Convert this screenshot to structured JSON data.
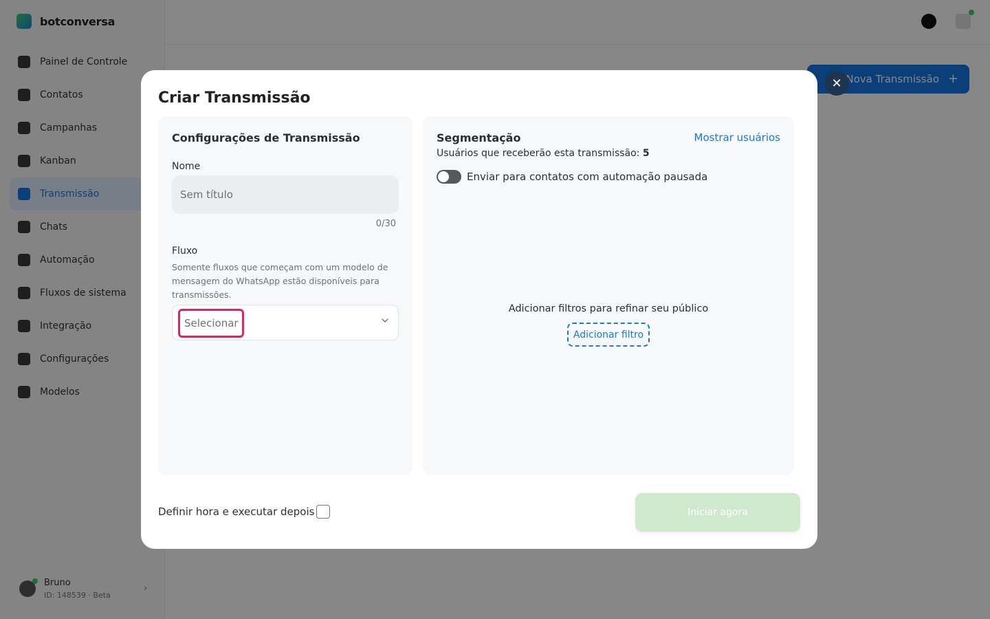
{
  "background": {
    "brand_name": "botconversa",
    "nav_items": [
      {
        "label": "Painel de Controle",
        "icon": "dashboard-icon"
      },
      {
        "label": "Contatos",
        "icon": "contacts-icon"
      },
      {
        "label": "Campanhas",
        "icon": "campaigns-icon"
      },
      {
        "label": "Kanban",
        "icon": "kanban-icon"
      },
      {
        "label": "Transmissão",
        "icon": "broadcast-icon",
        "active": true
      },
      {
        "label": "Chats",
        "icon": "chat-icon"
      },
      {
        "label": "Automação",
        "icon": "automation-icon"
      },
      {
        "label": "Fluxos de sistema",
        "icon": "flow-icon"
      },
      {
        "label": "Integração",
        "icon": "integration-icon"
      },
      {
        "label": "Configurações",
        "icon": "settings-icon"
      },
      {
        "label": "Modelos",
        "icon": "templates-icon"
      }
    ],
    "user": {
      "name": "Bruno",
      "sub": "ID: 148539 · Beta"
    },
    "new_button_label": "Nova Transmissão",
    "new_button_icon": "plus-icon"
  },
  "modal": {
    "title": "Criar Transmissão",
    "close_icon": "close-icon",
    "left_panel": {
      "heading": "Configurações de Transmissão",
      "name_label": "Nome",
      "name_placeholder": "Sem título",
      "name_value": "",
      "counter": "0/30",
      "flow_label": "Fluxo",
      "flow_help": "Somente fluxos que começam com um modelo de mensagem do WhatsApp estão disponíveis para transmissões.",
      "flow_select_placeholder": "Selecionar",
      "flow_select_icon": "chevron-down-icon"
    },
    "right_panel": {
      "heading": "Segmentação",
      "show_users_label": "Mostrar usuários",
      "recipients_text": "Usuários que receberão esta transmissão:",
      "recipients_count": "5",
      "toggle_label": "Enviar para contatos com automação pausada",
      "toggle_on": false,
      "empty_text": "Adicionar filtros para refinar seu público",
      "add_filter_label": "Adicionar filtro"
    },
    "footer": {
      "schedule_label": "Definir hora e executar depois",
      "schedule_checked": false,
      "start_label": "Iniciar agora"
    }
  },
  "colors": {
    "accent": "#1677e5",
    "highlight": "#e0245e",
    "start_disabled": "#cfe9cc",
    "close_button": "#1e3550"
  }
}
